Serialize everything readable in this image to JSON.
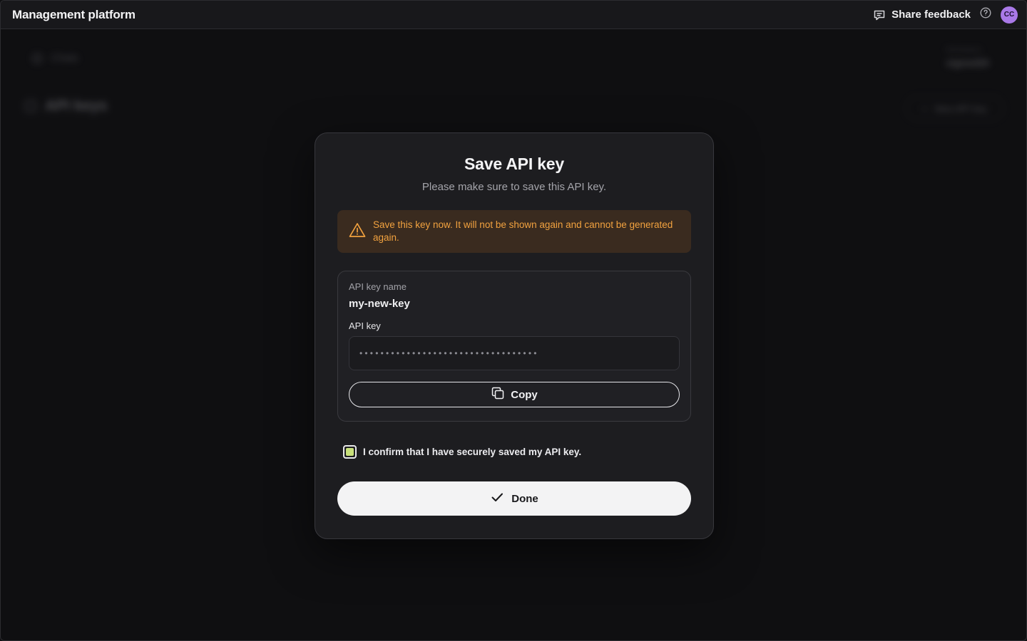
{
  "topbar": {
    "title": "Management platform",
    "feedback_label": "Share feedback",
    "avatar_initials": "CC"
  },
  "background": {
    "search_label": "Chats",
    "workspace_label": "Workspace",
    "workspace_value": "signed20",
    "page_title": "API keys",
    "new_key_label": "New API key"
  },
  "modal": {
    "title": "Save API key",
    "subtitle": "Please make sure to save this API key.",
    "warning_text": "Save this key now. It will not be shown again and cannot be generated again.",
    "key_name_label": "API key name",
    "key_name_value": "my-new-key",
    "api_key_label": "API key",
    "api_key_masked": "••••••••••••••••••••••••••••••••••",
    "copy_label": "Copy",
    "confirm_label": "I confirm that I have securely saved my API key.",
    "confirm_checked": true,
    "done_label": "Done"
  },
  "colors": {
    "warning_bg": "#3a2b1f",
    "warning_text": "#f2a23f",
    "checkbox_fill": "#c8e07a",
    "avatar_bg": "#a979e8"
  }
}
